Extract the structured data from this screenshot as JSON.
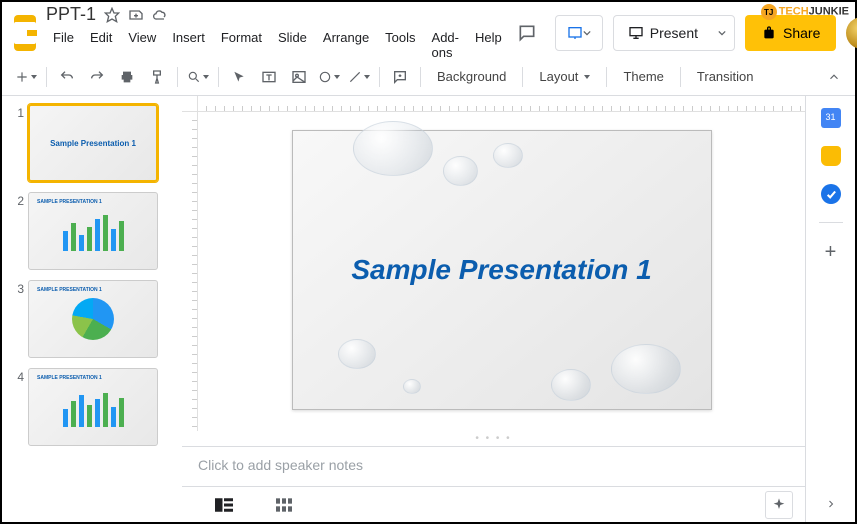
{
  "watermark": {
    "brand1": "TECH",
    "brand2": "JUNKIE",
    "badge": "TJ"
  },
  "doc": {
    "title": "PPT-1"
  },
  "menu": [
    "File",
    "Edit",
    "View",
    "Insert",
    "Format",
    "Slide",
    "Arrange",
    "Tools",
    "Add-ons",
    "Help"
  ],
  "header": {
    "present": "Present",
    "share": "Share"
  },
  "toolbar": {
    "background": "Background",
    "layout": "Layout",
    "theme": "Theme",
    "transition": "Transition"
  },
  "slides": [
    {
      "num": "1",
      "type": "title",
      "title": "Sample Presentation 1"
    },
    {
      "num": "2",
      "type": "bars",
      "label": "SAMPLE PRESENTATION 1"
    },
    {
      "num": "3",
      "type": "pie",
      "label": "SAMPLE PRESENTATION 1"
    },
    {
      "num": "4",
      "type": "bars",
      "label": "SAMPLE PRESENTATION 1"
    }
  ],
  "main_slide": {
    "title": "Sample Presentation 1"
  },
  "notes": {
    "placeholder": "Click to add speaker notes"
  },
  "sidebar": {
    "calendar_day": "31"
  }
}
